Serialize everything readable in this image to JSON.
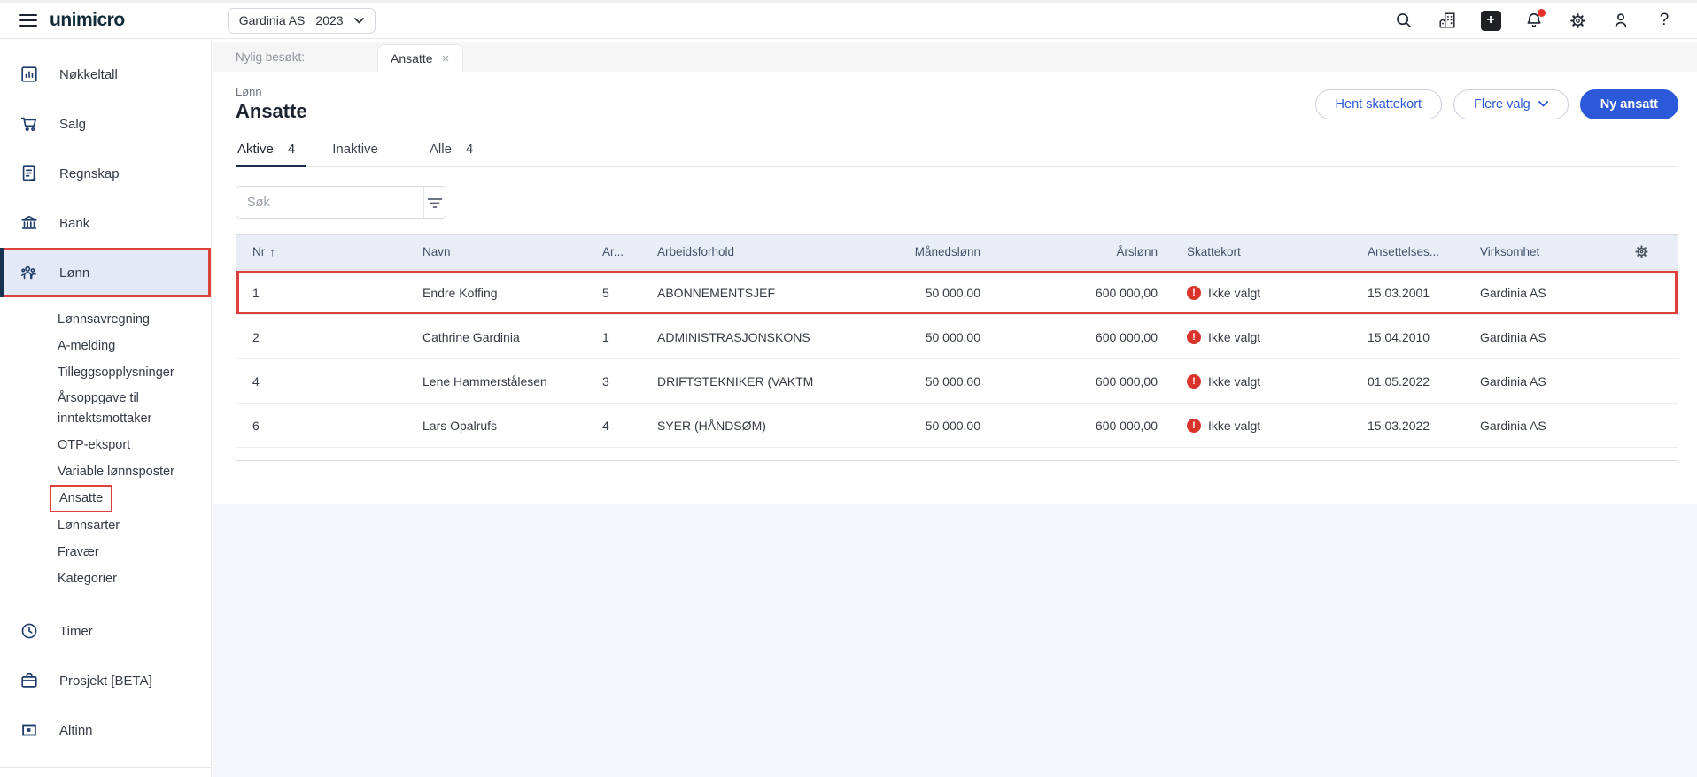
{
  "topbar": {
    "logo": "unimicro",
    "company": "Gardinia AS",
    "year": "2023",
    "icons": [
      "search-icon",
      "company-icon",
      "add-icon",
      "notifications-icon",
      "settings-icon",
      "account-icon",
      "help-icon"
    ]
  },
  "sidebar": {
    "items": [
      {
        "label": "Nøkkeltall",
        "icon": "bar-chart-icon"
      },
      {
        "label": "Salg",
        "icon": "cart-icon"
      },
      {
        "label": "Regnskap",
        "icon": "ledger-icon"
      },
      {
        "label": "Bank",
        "icon": "bank-icon"
      },
      {
        "label": "Lønn",
        "icon": "people-icon",
        "active": true
      }
    ],
    "lonn_submenu": [
      {
        "label": "Lønnsavregning"
      },
      {
        "label": "A-melding"
      },
      {
        "label": "Tilleggsopplysninger"
      },
      {
        "label": "Årsoppgave til inntektsmottaker"
      },
      {
        "label": "OTP-eksport"
      },
      {
        "label": "Variable lønnsposter"
      },
      {
        "label": "Ansatte",
        "highlighted": true
      },
      {
        "label": "Lønnsarter"
      },
      {
        "label": "Fravær"
      },
      {
        "label": "Kategorier"
      }
    ],
    "bottom_items": [
      {
        "label": "Timer",
        "icon": "clock-icon"
      },
      {
        "label": "Prosjekt [BETA]",
        "icon": "briefcase-icon"
      },
      {
        "label": "Altinn",
        "icon": "altinn-icon"
      }
    ]
  },
  "recent": {
    "label": "Nylig besøkt:",
    "tab": "Ansatte"
  },
  "header": {
    "eyebrow": "Lønn",
    "title": "Ansatte",
    "hent_skattekort": "Hent skattekort",
    "flere_valg": "Flere valg",
    "ny_ansatt": "Ny ansatt"
  },
  "view_tabs": [
    {
      "label": "Aktive",
      "count": "4",
      "active": true
    },
    {
      "label": "Inaktive",
      "count": ""
    },
    {
      "label": "Alle",
      "count": "4"
    }
  ],
  "search": {
    "placeholder": "Søk"
  },
  "table": {
    "columns": {
      "nr": "Nr",
      "navn": "Navn",
      "ar": "Ar...",
      "arbeidsforhold": "Arbeidsforhold",
      "manedslonn": "Månedslønn",
      "arslonn": "Årslønn",
      "skattekort": "Skattekort",
      "ansettelses": "Ansettelses...",
      "virksomhet": "Virksomhet"
    },
    "rows": [
      {
        "nr": "1",
        "navn": "Endre Koffing",
        "ar": "5",
        "arbeidsforhold": "ABONNEMENTSJEF",
        "manedslonn": "50 000,00",
        "arslonn": "600 000,00",
        "skattekort": "Ikke valgt",
        "ansettelses": "15.03.2001",
        "virksomhet": "Gardinia AS",
        "highlighted": true
      },
      {
        "nr": "2",
        "navn": "Cathrine Gardinia",
        "ar": "1",
        "arbeidsforhold": "ADMINISTRASJONSKONS",
        "manedslonn": "50 000,00",
        "arslonn": "600 000,00",
        "skattekort": "Ikke valgt",
        "ansettelses": "15.04.2010",
        "virksomhet": "Gardinia AS"
      },
      {
        "nr": "4",
        "navn": "Lene Hammerstålesen",
        "ar": "3",
        "arbeidsforhold": "DRIFTSTEKNIKER (VAKTM",
        "manedslonn": "50 000,00",
        "arslonn": "600 000,00",
        "skattekort": "Ikke valgt",
        "ansettelses": "01.05.2022",
        "virksomhet": "Gardinia AS"
      },
      {
        "nr": "6",
        "navn": "Lars Opalrufs",
        "ar": "4",
        "arbeidsforhold": "SYER (HÅNDSØM)",
        "manedslonn": "50 000,00",
        "arslonn": "600 000,00",
        "skattekort": "Ikke valgt",
        "ansettelses": "15.03.2022",
        "virksomhet": "Gardinia AS"
      }
    ]
  },
  "colors": {
    "accent_blue": "#2b59d9",
    "highlight_red": "#de403b",
    "alert_red": "#d8342c",
    "navy": "#1d3c6b",
    "table_header_bg": "#e9eef6",
    "page_bg": "#f4f5f8"
  }
}
